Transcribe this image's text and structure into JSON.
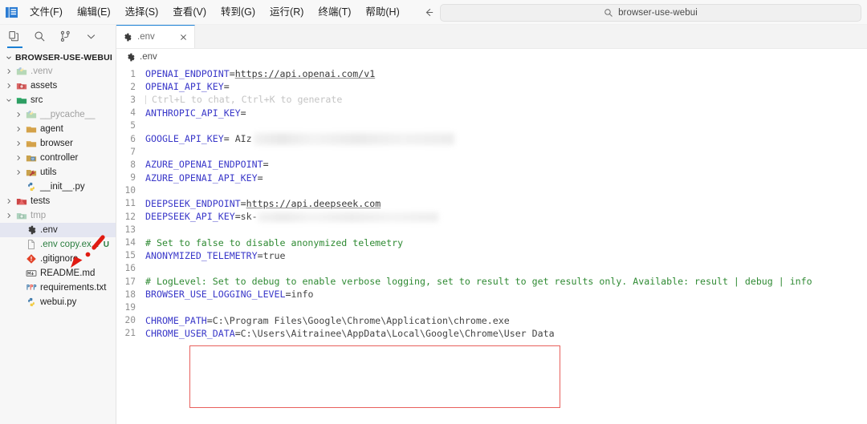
{
  "window": {
    "app_icon": "vscode-logo-icon",
    "menus": [
      {
        "label": "文件(F)",
        "name": "menu-file"
      },
      {
        "label": "编辑(E)",
        "name": "menu-edit"
      },
      {
        "label": "选择(S)",
        "name": "menu-selection"
      },
      {
        "label": "查看(V)",
        "name": "menu-view"
      },
      {
        "label": "转到(G)",
        "name": "menu-go"
      },
      {
        "label": "运行(R)",
        "name": "menu-run"
      },
      {
        "label": "终端(T)",
        "name": "menu-terminal"
      },
      {
        "label": "帮助(H)",
        "name": "menu-help"
      }
    ],
    "nav_back": "◀",
    "nav_forward": "▶",
    "quick_input": {
      "icon": "search-icon",
      "value": "browser-use-webui"
    }
  },
  "sidebar": {
    "activity_icons": [
      "explorer-icon",
      "search-icon",
      "source-control-icon",
      "chevron-down-icon"
    ],
    "root_label": "BROWSER-USE-WEBUI",
    "tree": [
      {
        "label": ".venv",
        "indent": 1,
        "arrow": "collapsed",
        "icon": "python-folder-icon",
        "state": "dim"
      },
      {
        "label": "assets",
        "indent": 1,
        "arrow": "collapsed",
        "icon": "assets-folder-icon",
        "state": "normal"
      },
      {
        "label": "src",
        "indent": 1,
        "arrow": "expanded",
        "icon": "src-folder-icon",
        "state": "normal"
      },
      {
        "label": "__pycache__",
        "indent": 2,
        "arrow": "collapsed",
        "icon": "python-folder-icon",
        "state": "dim"
      },
      {
        "label": "agent",
        "indent": 2,
        "arrow": "collapsed",
        "icon": "folder-icon",
        "state": "normal"
      },
      {
        "label": "browser",
        "indent": 2,
        "arrow": "collapsed",
        "icon": "folder-icon",
        "state": "normal"
      },
      {
        "label": "controller",
        "indent": 2,
        "arrow": "collapsed",
        "icon": "controller-folder-icon",
        "state": "normal"
      },
      {
        "label": "utils",
        "indent": 2,
        "arrow": "collapsed",
        "icon": "utils-folder-icon",
        "state": "normal"
      },
      {
        "label": "__init__.py",
        "indent": 2,
        "arrow": "none",
        "icon": "python-file-icon",
        "state": "normal"
      },
      {
        "label": "tests",
        "indent": 1,
        "arrow": "collapsed",
        "icon": "tests-folder-icon",
        "state": "normal"
      },
      {
        "label": "tmp",
        "indent": 1,
        "arrow": "collapsed",
        "icon": "tmp-folder-icon",
        "state": "dim"
      },
      {
        "label": ".env",
        "indent": 2,
        "arrow": "none",
        "icon": "gear-icon",
        "state": "selected"
      },
      {
        "label": ".env copy.ex...",
        "indent": 2,
        "arrow": "none",
        "icon": "file-icon",
        "state": "added",
        "badge": "U"
      },
      {
        "label": ".gitignore",
        "indent": 2,
        "arrow": "none",
        "icon": "git-icon",
        "state": "normal"
      },
      {
        "label": "README.md",
        "indent": 2,
        "arrow": "none",
        "icon": "markdown-icon",
        "state": "normal"
      },
      {
        "label": "requirements.txt",
        "indent": 2,
        "arrow": "none",
        "icon": "requirements-icon",
        "state": "normal"
      },
      {
        "label": "webui.py",
        "indent": 2,
        "arrow": "none",
        "icon": "python-file-icon",
        "state": "normal"
      }
    ]
  },
  "annotations": {
    "arrow_color": "#e01b12",
    "arrow_target": ".env",
    "box_color": "#e8605c",
    "box_target_lines": [
      20,
      21
    ]
  },
  "editor": {
    "tab": {
      "label": ".env",
      "icon": "gear-icon",
      "close_icon": "close-icon"
    },
    "breadcrumb": {
      "label": ".env",
      "icon": "gear-icon"
    },
    "lines": [
      {
        "n": 1,
        "parts": [
          {
            "t": "OPENAI_ENDPOINT",
            "c": "k"
          },
          {
            "t": "=",
            "c": "eq"
          },
          {
            "t": "https://api.openai.com/v1",
            "c": "link"
          }
        ]
      },
      {
        "n": 2,
        "parts": [
          {
            "t": "OPENAI_API_KEY",
            "c": "k"
          },
          {
            "t": "=",
            "c": "eq"
          }
        ]
      },
      {
        "n": 3,
        "parts": [
          {
            "t": "Ctrl+L to chat, Ctrl+K to generate",
            "c": "ghost"
          }
        ]
      },
      {
        "n": 4,
        "parts": [
          {
            "t": "ANTHROPIC_API_KEY",
            "c": "k"
          },
          {
            "t": "=",
            "c": "eq"
          }
        ]
      },
      {
        "n": 5,
        "parts": []
      },
      {
        "n": 6,
        "parts": [
          {
            "t": "GOOGLE_API_KEY",
            "c": "k"
          },
          {
            "t": "= ",
            "c": "eq"
          },
          {
            "t": "AIz",
            "c": "v"
          },
          {
            "t": "",
            "c": "blur1"
          }
        ]
      },
      {
        "n": 7,
        "parts": []
      },
      {
        "n": 8,
        "parts": [
          {
            "t": "AZURE_OPENAI_ENDPOINT",
            "c": "k"
          },
          {
            "t": "=",
            "c": "eq"
          }
        ]
      },
      {
        "n": 9,
        "parts": [
          {
            "t": "AZURE_OPENAI_API_KEY",
            "c": "k"
          },
          {
            "t": "=",
            "c": "eq"
          }
        ]
      },
      {
        "n": 10,
        "parts": []
      },
      {
        "n": 11,
        "parts": [
          {
            "t": "DEEPSEEK_ENDPOINT",
            "c": "k"
          },
          {
            "t": "=",
            "c": "eq"
          },
          {
            "t": "https://api.deepseek.com",
            "c": "link"
          }
        ]
      },
      {
        "n": 12,
        "parts": [
          {
            "t": "DEEPSEEK_API_KEY",
            "c": "k"
          },
          {
            "t": "=",
            "c": "eq"
          },
          {
            "t": "sk-",
            "c": "v"
          },
          {
            "t": "",
            "c": "blur2"
          }
        ]
      },
      {
        "n": 13,
        "parts": []
      },
      {
        "n": 14,
        "parts": [
          {
            "t": "# Set to false to disable anonymized telemetry",
            "c": "cm"
          }
        ]
      },
      {
        "n": 15,
        "parts": [
          {
            "t": "ANONYMIZED_TELEMETRY",
            "c": "k"
          },
          {
            "t": "=",
            "c": "eq"
          },
          {
            "t": "true",
            "c": "v"
          }
        ]
      },
      {
        "n": 16,
        "parts": []
      },
      {
        "n": 17,
        "parts": [
          {
            "t": "# LogLevel: Set to debug to enable verbose logging, set to result to get results only. Available: result | debug | info",
            "c": "cm"
          }
        ]
      },
      {
        "n": 18,
        "parts": [
          {
            "t": "BROWSER_USE_LOGGING_LEVEL",
            "c": "k"
          },
          {
            "t": "=",
            "c": "eq"
          },
          {
            "t": "info",
            "c": "v"
          }
        ]
      },
      {
        "n": 19,
        "parts": []
      },
      {
        "n": 20,
        "parts": [
          {
            "t": "CHROME_PATH",
            "c": "k"
          },
          {
            "t": "=",
            "c": "eq"
          },
          {
            "t": "C:\\Program Files\\Google\\Chrome\\Application\\chrome.exe",
            "c": "v"
          }
        ]
      },
      {
        "n": 21,
        "parts": [
          {
            "t": "CHROME_USER_DATA",
            "c": "k"
          },
          {
            "t": "=",
            "c": "eq"
          },
          {
            "t": "C:\\Users\\Aitrainee\\AppData\\Local\\Google\\Chrome\\User Data",
            "c": "v"
          }
        ]
      }
    ]
  }
}
